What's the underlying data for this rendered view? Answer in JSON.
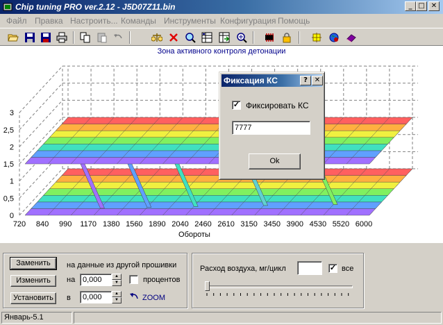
{
  "window": {
    "title": "Chip tuning PRO ver.2.12  -  J5D07Z11.bin",
    "minimize": "_",
    "maximize": "□",
    "close": "✕"
  },
  "menu": [
    {
      "label": "Файл"
    },
    {
      "label": "Правка"
    },
    {
      "label": "Настроить..."
    },
    {
      "label": "Команды"
    },
    {
      "label": "Инструменты"
    },
    {
      "label": "Конфигурация"
    },
    {
      "label": "Помощь"
    }
  ],
  "toolbar": [
    {
      "name": "open-folder-icon"
    },
    {
      "name": "save-icon"
    },
    {
      "name": "save-as-icon"
    },
    {
      "name": "print-icon"
    },
    {
      "name": "copy-icon"
    },
    {
      "name": "paste-icon"
    },
    {
      "name": "undo-icon"
    },
    {
      "name": "scale-icon"
    },
    {
      "name": "delete-icon"
    },
    {
      "name": "find-icon"
    },
    {
      "name": "table-icon"
    },
    {
      "name": "table-arrow-icon"
    },
    {
      "name": "zoom-icon"
    },
    {
      "name": "chip-icon"
    },
    {
      "name": "lock-icon"
    },
    {
      "name": "tune-icon"
    },
    {
      "name": "globe-icon"
    },
    {
      "name": "book-icon"
    }
  ],
  "chart_data": {
    "type": "3d-surface",
    "title": "Зона активного контроля детонации",
    "xlabel": "Обороты",
    "x_ticks": [
      "720",
      "840",
      "990",
      "1170",
      "1380",
      "1560",
      "1890",
      "2040",
      "2460",
      "2610",
      "3150",
      "3450",
      "3900",
      "4530",
      "5520",
      "6000"
    ],
    "y_ticks": [
      "0",
      "0,5",
      "1",
      "1,5",
      "2",
      "2,5",
      "3"
    ],
    "ylim": [
      0,
      3
    ],
    "surfaces": [
      {
        "level": 0,
        "span": [
          0,
          15
        ]
      },
      {
        "level": 1.5,
        "span": [
          0,
          15
        ]
      }
    ],
    "transitions": [
      {
        "from": 2,
        "to": 3
      },
      {
        "from": 4,
        "to": 5
      },
      {
        "from": 6,
        "to": 7
      },
      {
        "from": 9,
        "to": 10
      },
      {
        "from": 12,
        "to": 13
      }
    ]
  },
  "controls": {
    "replace_btn": "Заменить",
    "change_btn": "Изменить",
    "set_btn": "Установить",
    "from_other_label": "на данные из другой прошивки",
    "na_label": "на",
    "v_label": "в",
    "value1": "0,000",
    "value2": "0,000",
    "percent_label": "процентов",
    "zoom_label": "ZOOM",
    "airflow_label": "Расход воздуха, мг/цикл",
    "airflow_value": "",
    "all_label": "все",
    "all_checked": "✓"
  },
  "status": {
    "pane1": "Январь-5.1",
    "pane2": ""
  },
  "dialog": {
    "title": "Фиксация КС",
    "help": "?",
    "close": "✕",
    "checkbox_label": "Фиксировать КС",
    "checkbox_mark": "✓",
    "input_value": "7777",
    "ok": "Ok"
  }
}
